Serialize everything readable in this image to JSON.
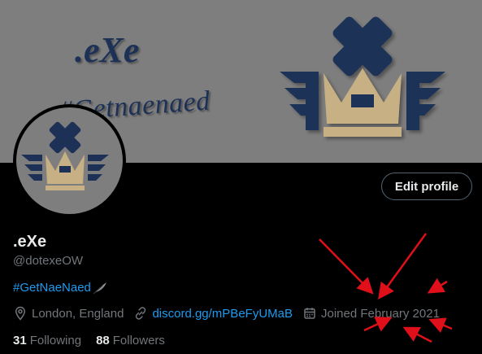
{
  "banner": {
    "title_text": ".eXe",
    "hashtag_text": "#Getnaenaed",
    "navy": "#1d3157",
    "gold": "#c7b083",
    "background": "#7e7e7e"
  },
  "profile": {
    "display_name": ".eXe",
    "handle": "@dotexeOW",
    "bio_hashtag": "#GetNaeNaed",
    "bio_emoji": "feather-icon",
    "location": "London, England",
    "website": "discord.gg/mPBeFyUMaB",
    "joined": "Joined February 2021",
    "following_count": "31",
    "following_label": "Following",
    "followers_count": "88",
    "followers_label": "Followers"
  },
  "actions": {
    "edit_profile": "Edit profile"
  },
  "theme": {
    "accent": "#1d9bf0",
    "text_primary": "#e7e9ea",
    "text_secondary": "#71767b",
    "annotation_arrow": "#e0101a"
  }
}
